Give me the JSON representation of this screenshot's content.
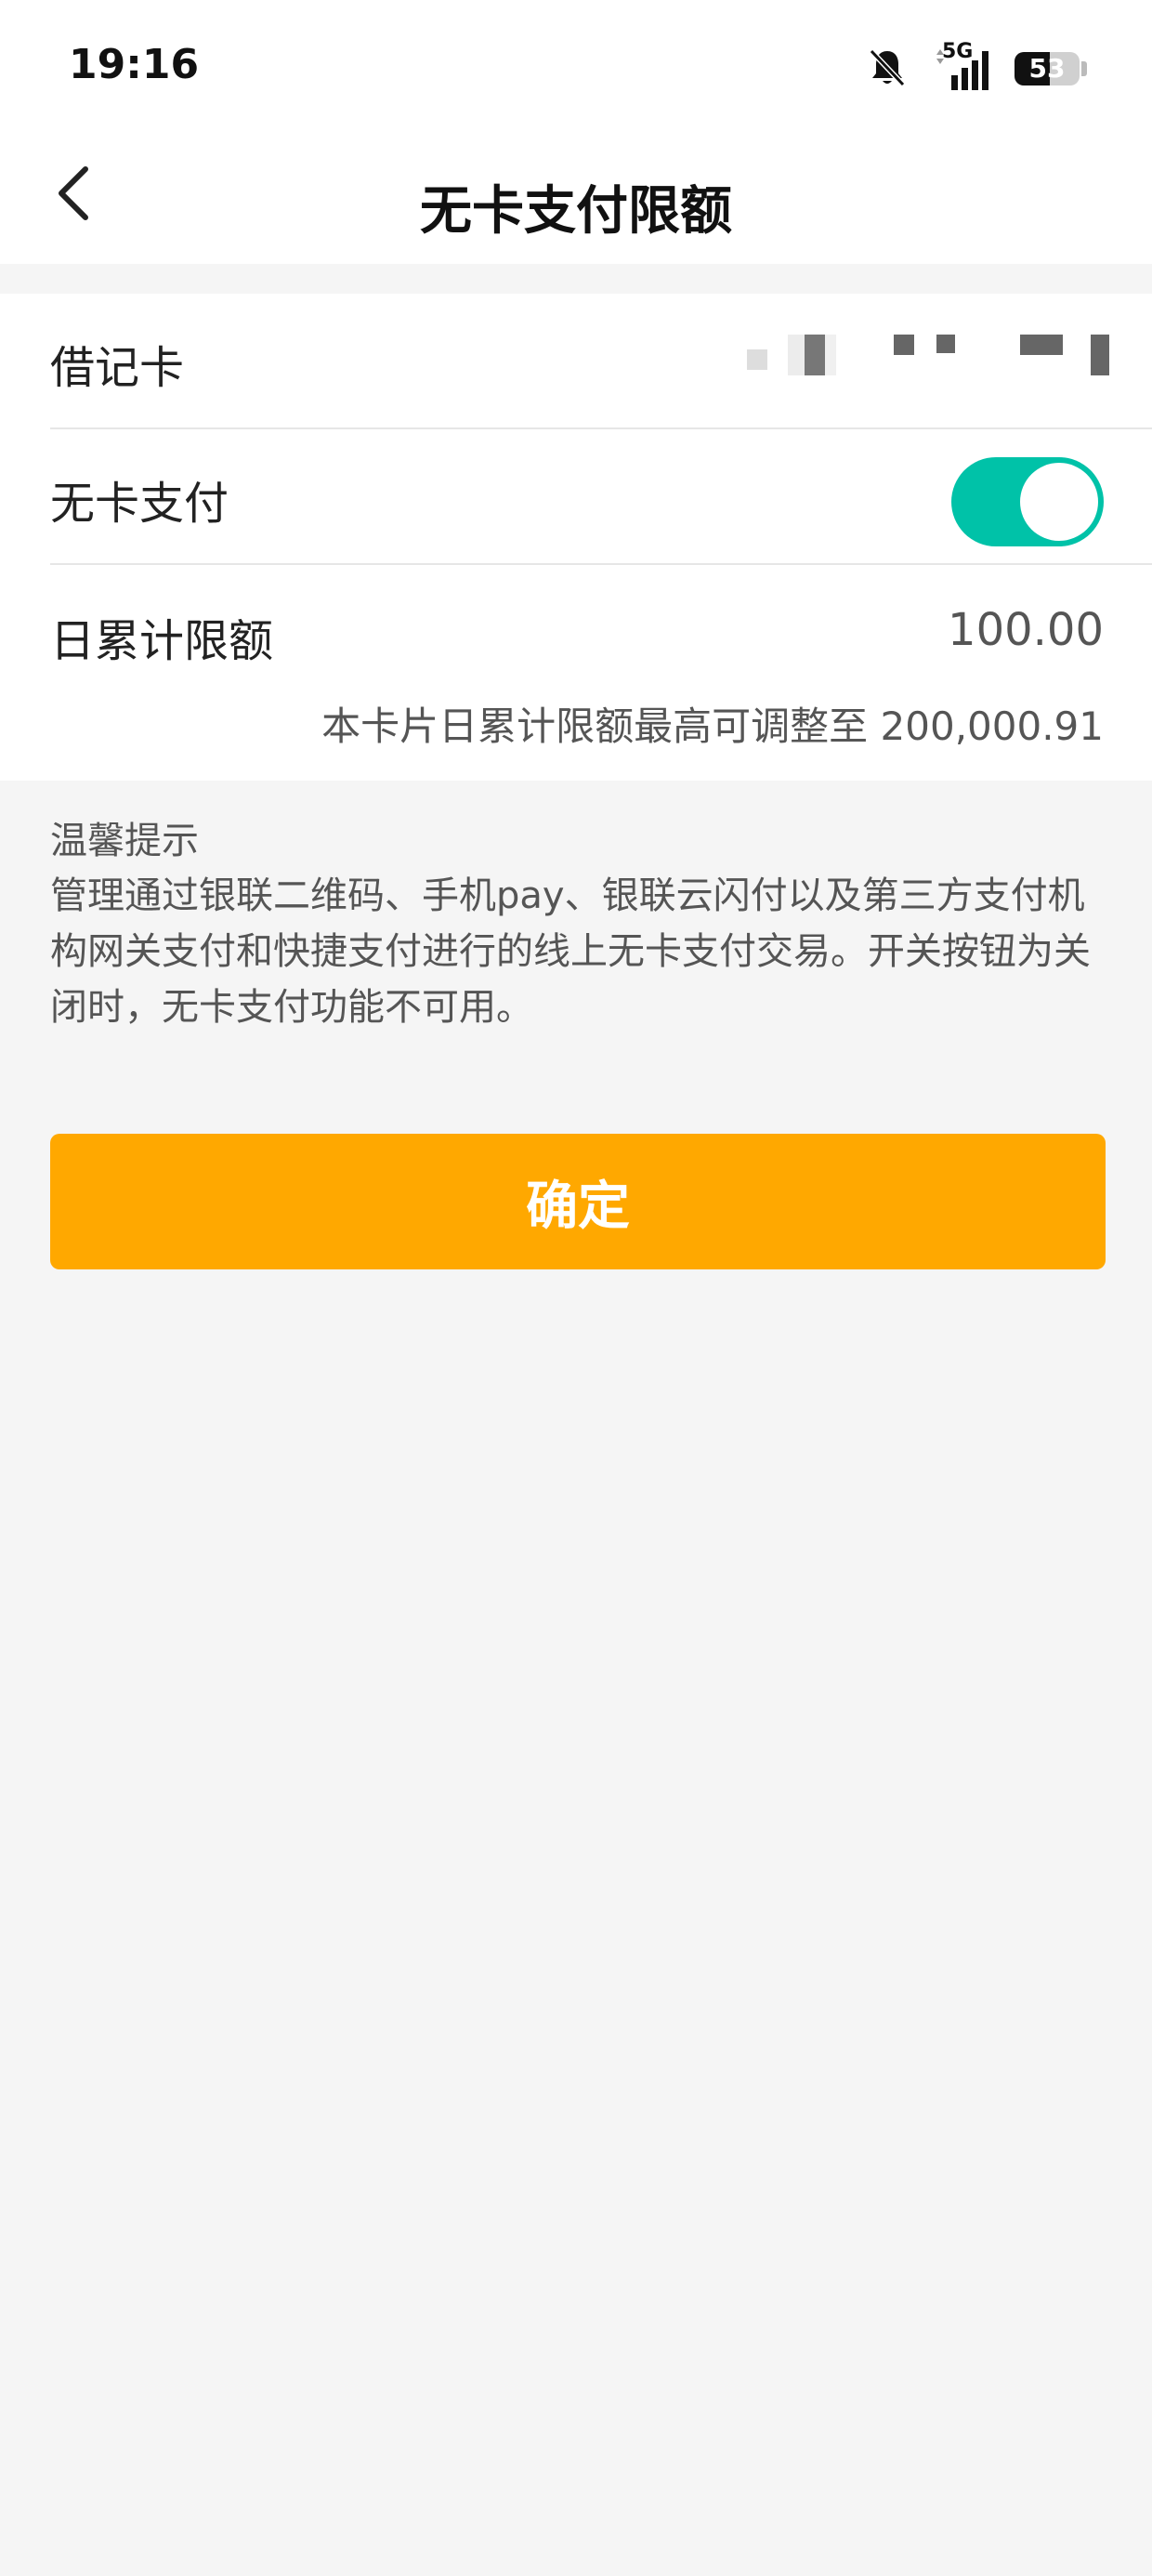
{
  "status_bar": {
    "time": "19:16",
    "network": "5G",
    "battery": "53"
  },
  "nav": {
    "title": "无卡支付限额"
  },
  "card": {
    "debit_label": "借记卡",
    "no_card_pay_label": "无卡支付",
    "no_card_pay_enabled": true,
    "daily_limit_label": "日累计限额",
    "daily_limit_value": "100.00",
    "daily_limit_note": "本卡片日累计限额最高可调整至 200,000.91"
  },
  "tips": {
    "title": "温馨提示",
    "body": "管理通过银联二维码、手机pay、银联云闪付以及第三方支付机构网关支付和快捷支付进行的线上无卡支付交易。开关按钮为关闭时，无卡支付功能不可用。"
  },
  "confirm_button": {
    "label": "确定"
  },
  "colors": {
    "accent": "#ffa800",
    "toggle_on": "#00c2a8"
  }
}
